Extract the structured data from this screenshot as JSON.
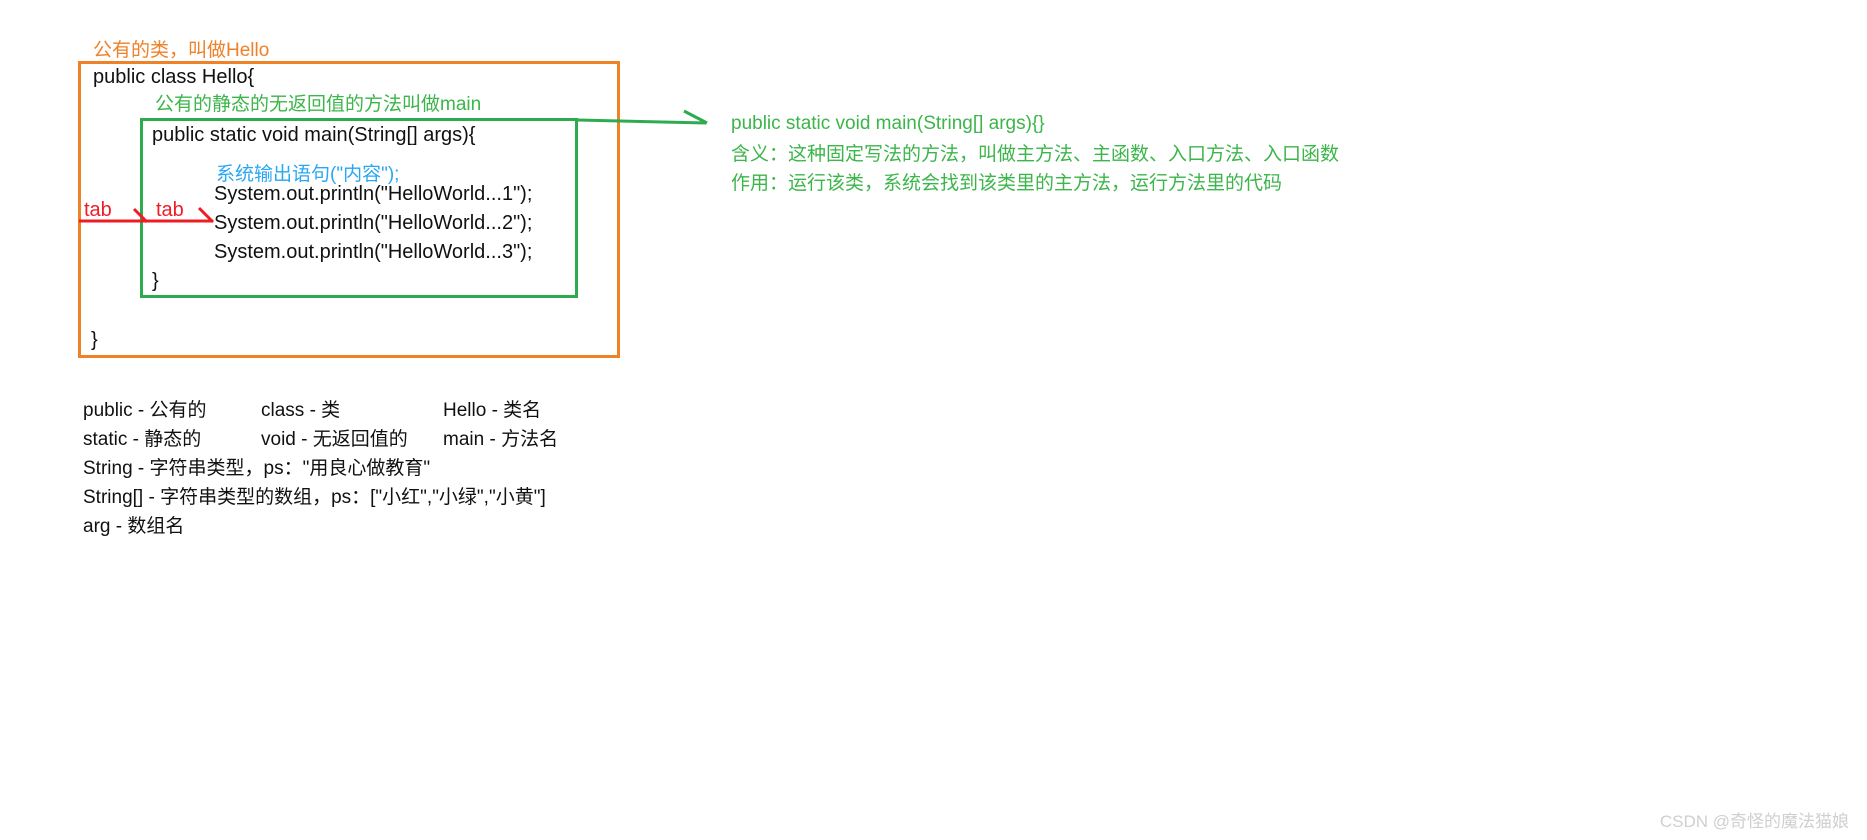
{
  "colors": {
    "orange": "#ef8127",
    "green": "#3cb54a",
    "green_box": "#2eab4e",
    "blue": "#29a7f2",
    "red": "#ee1c25",
    "text": "#111111",
    "watermark": "#cfcfcf",
    "background": "#ffffff"
  },
  "annotations": {
    "class_comment": "公有的类，叫做Hello",
    "method_comment": "公有的静态的无返回值的方法叫做main",
    "print_comment": "系统输出语句(\"内容\");",
    "tab_label_1": "tab",
    "tab_label_2": "tab"
  },
  "code": {
    "line_class_decl": "public class Hello{",
    "line_main_decl": "public static void main(String[] args){",
    "line_print_1": "System.out.println(\"HelloWorld...1\");",
    "line_print_2": "System.out.println(\"HelloWorld...2\");",
    "line_print_3": "System.out.println(\"HelloWorld...3\");",
    "line_close_method": "}",
    "line_close_class": "}"
  },
  "note": {
    "signature": "public static void main(String[] args){}",
    "meaning": "含义：这种固定写法的方法，叫做主方法、主函数、入口方法、入口函数",
    "purpose": "作用：运行该类，系统会找到该类里的主方法，运行方法里的代码"
  },
  "legend": {
    "rows": [
      [
        "public - 公有的",
        "class - 类",
        "Hello - 类名"
      ],
      [
        "static - 静态的",
        "void - 无返回值的",
        "main - 方法名"
      ],
      [
        "String - 字符串类型，ps：\"用良心做教育\"",
        "",
        ""
      ],
      [
        "String[] - 字符串类型的数组，ps：[\"小红\",\"小绿\",\"小黄\"]",
        "",
        ""
      ],
      [
        "arg - 数组名",
        "",
        ""
      ]
    ]
  },
  "watermark": {
    "text": "CSDN @奇怪的魔法猫娘"
  }
}
